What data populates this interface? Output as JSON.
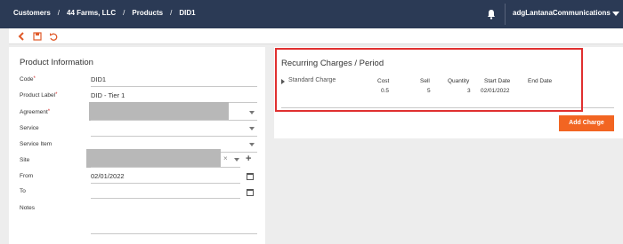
{
  "breadcrumb": [
    "Customers",
    "44 Farms, LLC",
    "Products",
    "DID1"
  ],
  "breadcrumb_separator": "/",
  "user": {
    "name": "adgLantanaCommunications"
  },
  "toolbar": {
    "icons": [
      "back-arrow-icon",
      "save-icon",
      "undo-icon"
    ],
    "accent": "#e05a2a"
  },
  "product_info": {
    "title": "Product Information",
    "fields": {
      "code": {
        "label": "Code",
        "value": "DID1",
        "required": true
      },
      "product_label": {
        "label": "Product Label",
        "value": "DID - Tier 1",
        "required": true
      },
      "agreement": {
        "label": "Agreement",
        "value": "",
        "required": true
      },
      "service": {
        "label": "Service",
        "value": ""
      },
      "service_item": {
        "label": "Service Item",
        "value": ""
      },
      "site": {
        "label": "Site",
        "value": ""
      },
      "from": {
        "label": "From",
        "value": "02/01/2022"
      },
      "to": {
        "label": "To",
        "value": ""
      },
      "notes": {
        "label": "Notes",
        "value": ""
      }
    },
    "required_marker": "*"
  },
  "recurring": {
    "title": "Recurring Charges / Period",
    "columns": [
      "Cost",
      "Sell",
      "Quantity",
      "Start Date",
      "End Date"
    ],
    "row": {
      "name": "Standard Charge",
      "cost": "0.5",
      "sell": "5",
      "quantity": "3",
      "start_date": "02/01/2022",
      "end_date": ""
    },
    "add_button": "Add Charge"
  },
  "colors": {
    "topbar": "#2b3a55",
    "button": "#f26522",
    "highlight": "#e03030"
  }
}
